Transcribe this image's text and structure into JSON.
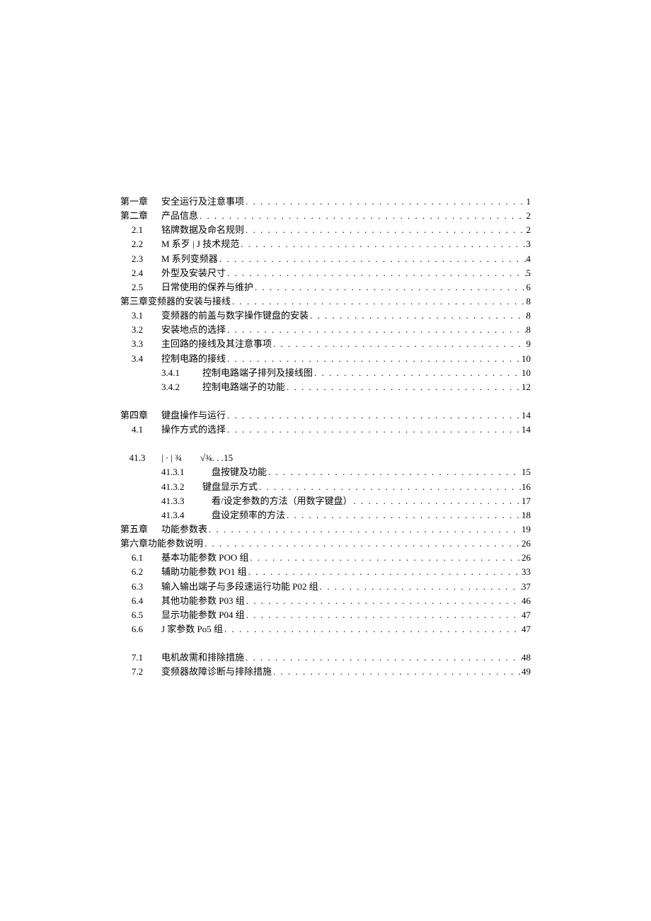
{
  "entries": [
    {
      "level": "level-0",
      "label": "第一章",
      "title": "安全运行及注意事项",
      "dots": true,
      "page": "1"
    },
    {
      "level": "level-0",
      "label": "第二章",
      "title": "产品信息",
      "dots": true,
      "page": "2"
    },
    {
      "level": "level-1",
      "label": "2.1",
      "title": "铭牌数据及命名规则",
      "dots": true,
      "page": "2"
    },
    {
      "level": "level-1",
      "label": "2.2",
      "title": "M 系歹 | J 技术规范",
      "dots": true,
      "page": "3"
    },
    {
      "level": "level-1",
      "label": "2.3",
      "title": "M 系列变频器",
      "dots": true,
      "page": "4"
    },
    {
      "level": "level-1",
      "label": "2.4",
      "title": "外型及安装尺寸",
      "dots": true,
      "page": "5"
    },
    {
      "level": "level-1",
      "label": "2.5",
      "title": "日常使用的保养与维护",
      "dots": true,
      "page": "6"
    },
    {
      "level": "level-0-nolabel",
      "label": "",
      "title": "第三章变频器的安装与接线",
      "dots": true,
      "page": "8"
    },
    {
      "level": "level-1",
      "label": "3.1",
      "title": "变频器的前盖与数字操作键盘的安装",
      "dots": true,
      "page": "8"
    },
    {
      "level": "level-1",
      "label": "3.2",
      "title": "安装地点的选择",
      "dots": true,
      "page": "8"
    },
    {
      "level": "level-1",
      "label": "3.3",
      "title": "主回路的接线及其注意事项",
      "dots": true,
      "page": "9"
    },
    {
      "level": "level-1",
      "label": "3.4",
      "title": "控制电路的接线",
      "dots": true,
      "page": "10"
    },
    {
      "level": "level-2",
      "label": "3.4.1",
      "title": "控制电路端子排列及接线图",
      "dots": true,
      "page": "10"
    },
    {
      "level": "level-2",
      "label": "3.4.2",
      "title": "控制电路端子的功能",
      "dots": true,
      "page": "12"
    },
    {
      "blank": true
    },
    {
      "level": "level-0",
      "label": "第四章",
      "title": "键盘操作与运行",
      "dots": true,
      "page": "14"
    },
    {
      "level": "level-1",
      "label": "4.1",
      "title": "操作方式的选择",
      "dots": true,
      "page": "14"
    },
    {
      "blank": true
    },
    {
      "level": "special-413",
      "label": "41.3",
      "title": "| · | ¾  √¾. . .15",
      "dots": false,
      "page": ""
    },
    {
      "level": "level-2",
      "label": "41.3.1",
      "title": " 盘按键及功能",
      "dots": true,
      "page": "15"
    },
    {
      "level": "level-2",
      "label": "41.3.2",
      "title": "键盘显示方式",
      "dots": true,
      "page": "16"
    },
    {
      "level": "level-2",
      "label": "41.3.3",
      "title": " 看/设定参数的方法（用数字键盘）",
      "dots": true,
      "page": "17"
    },
    {
      "level": "level-2",
      "label": "41.3.4",
      "title": " 盘设定频率的方法",
      "dots": true,
      "page": "18"
    },
    {
      "level": "level-0",
      "label": "第五章",
      "title": "功能参数表",
      "dots": true,
      "page": "19"
    },
    {
      "level": "level-0-nolabel",
      "label": "",
      "title": "第六章功能参数说明",
      "dots": true,
      "page": "26"
    },
    {
      "level": "level-1",
      "label": "6.1",
      "title": "基本功能参数 POO 组",
      "dots": true,
      "page": "26"
    },
    {
      "level": "level-1",
      "label": "6.2",
      "title": "辅助功能参数 PO1 组",
      "dots": true,
      "page": "33"
    },
    {
      "level": "level-1",
      "label": "6.3",
      "title": "输入输出端子与多段速运行功能 P02 组",
      "dots": true,
      "page": "37"
    },
    {
      "level": "level-1",
      "label": "6.4",
      "title": "其他功能参数 P03 组",
      "dots": true,
      "page": "46"
    },
    {
      "level": "level-1",
      "label": "6.5",
      "title": "显示功能参数 P04 组",
      "dots": true,
      "page": "47"
    },
    {
      "level": "level-1",
      "label": "6.6",
      "title": "J 家参数 Po5 组",
      "dots": true,
      "page": "47"
    },
    {
      "blank": true
    },
    {
      "level": "level-1",
      "label": "7.1",
      "title": "电机故需和排除措施",
      "dots": true,
      "page": "48"
    },
    {
      "level": "level-1",
      "label": "7.2",
      "title": "变频器故障诊断与排除措施",
      "dots": true,
      "page": "49"
    }
  ]
}
